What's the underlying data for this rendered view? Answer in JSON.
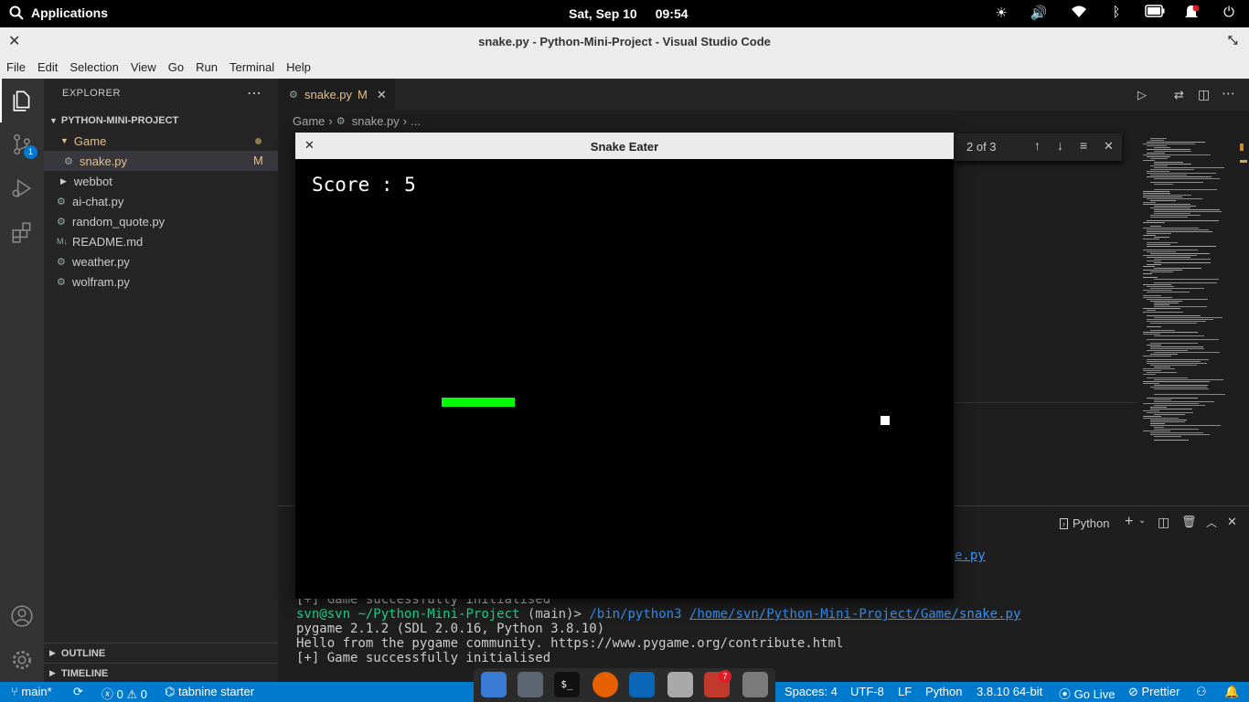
{
  "topbar": {
    "apps_label": "Applications",
    "date": "Sat, Sep 10",
    "time": "09:54",
    "tray_icons": [
      "brightness-icon",
      "volume-icon",
      "wifi-icon",
      "bluetooth-icon",
      "battery-icon",
      "notifications-icon",
      "power-icon"
    ]
  },
  "window": {
    "title": "snake.py - Python-Mini-Project - Visual Studio Code"
  },
  "menu": [
    "File",
    "Edit",
    "Selection",
    "View",
    "Go",
    "Run",
    "Terminal",
    "Help"
  ],
  "activity": {
    "scm_badge": "1"
  },
  "explorer": {
    "header": "EXPLORER",
    "project": "PYTHON-MINI-PROJECT",
    "items": [
      {
        "name": "Game",
        "type": "folder"
      },
      {
        "name": "snake.py",
        "type": "file",
        "badge": "M"
      },
      {
        "name": "webbot",
        "type": "folder"
      },
      {
        "name": "ai-chat.py",
        "type": "file"
      },
      {
        "name": "random_quote.py",
        "type": "file"
      },
      {
        "name": "README.md",
        "type": "markdown"
      },
      {
        "name": "weather.py",
        "type": "file"
      },
      {
        "name": "wolfram.py",
        "type": "file"
      }
    ],
    "outline": "OUTLINE",
    "timeline": "TIMELINE"
  },
  "editor": {
    "tab_label": "snake.py",
    "tab_badge": "M",
    "breadcrumb": [
      "Game",
      "snake.py",
      "..."
    ],
    "find": {
      "count": "2 of 3"
    }
  },
  "terminal": {
    "profile": "Python",
    "lines": [
      "[+] Game successfully initialised",
      "pygame 2.1.2 (SDL 2.0.16, Python 3.8.10)",
      "Hello from the pygame community. https://www.pygame.org/contribute.html",
      "[+] Game successfully initialised"
    ],
    "prompt_user": "svn@svn",
    "prompt_path": "~/Python-Mini-Project",
    "prompt_branch": "(main)>",
    "command": "/bin/python3",
    "script_path": "/home/svn/Python-Mini-Project/Game/snake.py",
    "partial_link": "e.py"
  },
  "snake_window": {
    "title": "Snake Eater",
    "score_text": "Score : 5",
    "snake_color": "#00ff00",
    "food_color": "#ffffff"
  },
  "statusbar": {
    "branch": "main*",
    "errors": "0",
    "warnings": "0",
    "tabnine": "tabnine starter",
    "spaces": "Spaces: 4",
    "encoding": "UTF-8",
    "eol": "LF",
    "language": "Python",
    "interpreter": "3.8.10 64-bit",
    "golive": "Go Live",
    "prettier": "Prettier"
  },
  "dock": {
    "notification_count": "7"
  },
  "colors": {
    "accent": "#007acc",
    "modified": "#e2c08d"
  }
}
